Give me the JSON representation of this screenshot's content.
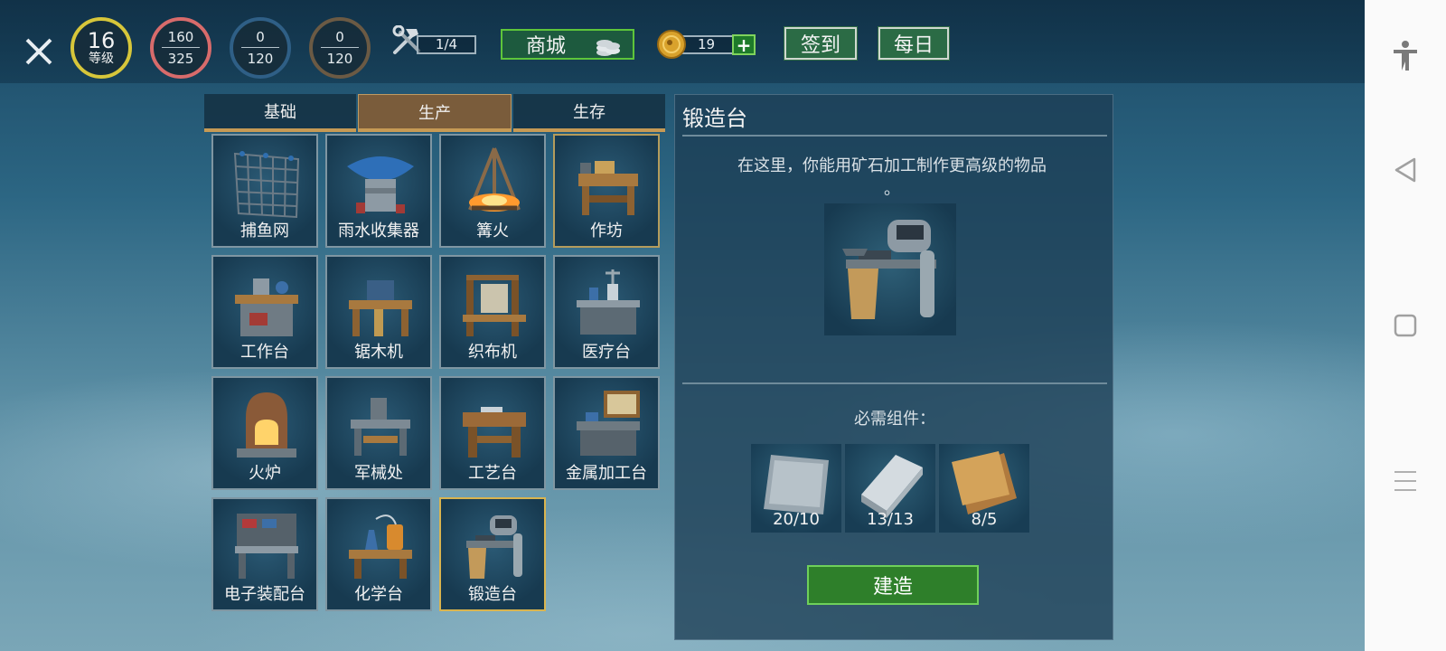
{
  "header": {
    "level": {
      "value": "16",
      "label": "等级"
    },
    "stats": [
      {
        "current": "160",
        "max": "325",
        "color": "#d86b6b"
      },
      {
        "current": "0",
        "max": "120",
        "color": "#2f5f86"
      },
      {
        "current": "0",
        "max": "120",
        "color": "#6b5a44"
      }
    ],
    "level_ring_color": "#d7c63a",
    "tools_count": "1/4",
    "shop_label": "商城",
    "coins": "19",
    "checkin_label": "签到",
    "daily_label": "每日"
  },
  "tabs": [
    {
      "label": "基础",
      "active": false
    },
    {
      "label": "生产",
      "active": true
    },
    {
      "label": "生存",
      "active": false
    }
  ],
  "items": [
    {
      "name": "捕鱼网",
      "icon": "fishing-net-icon"
    },
    {
      "name": "雨水收集器",
      "icon": "rain-collector-icon"
    },
    {
      "name": "篝火",
      "icon": "campfire-icon"
    },
    {
      "name": "作坊",
      "icon": "workshop-icon"
    },
    {
      "name": "工作台",
      "icon": "workbench-icon"
    },
    {
      "name": "锯木机",
      "icon": "sawmill-icon"
    },
    {
      "name": "织布机",
      "icon": "loom-icon"
    },
    {
      "name": "医疗台",
      "icon": "medical-table-icon"
    },
    {
      "name": "火炉",
      "icon": "furnace-icon"
    },
    {
      "name": "军械处",
      "icon": "armory-icon"
    },
    {
      "name": "工艺台",
      "icon": "crafting-table-icon"
    },
    {
      "name": "金属加工台",
      "icon": "metalworking-table-icon"
    },
    {
      "name": "电子装配台",
      "icon": "electronics-bench-icon"
    },
    {
      "name": "化学台",
      "icon": "chemistry-table-icon"
    },
    {
      "name": "锻造台",
      "icon": "forge-icon"
    }
  ],
  "selected_item": "锻造台",
  "detail": {
    "title": "锻造台",
    "description": "在这里，你能用矿石加工制作更高级的物品",
    "description_tail": "。",
    "required_label": "必需组件：",
    "materials": [
      {
        "count": "20/10",
        "icon": "metal-sheet-icon"
      },
      {
        "count": "13/13",
        "icon": "metal-ingot-icon"
      },
      {
        "count": "8/5",
        "icon": "leather-icon"
      }
    ],
    "build_label": "建造"
  },
  "colors": {
    "accent_green": "#2e7f2a",
    "tab_gold": "#c69a55",
    "selection": "#d9b44f"
  }
}
